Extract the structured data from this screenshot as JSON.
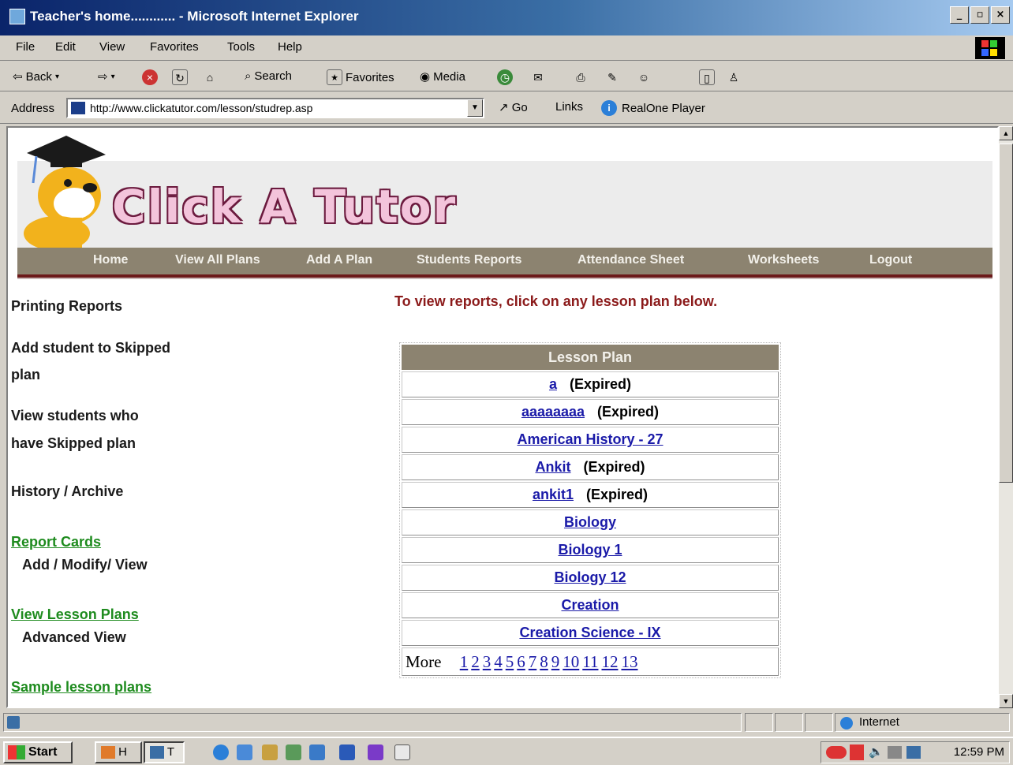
{
  "window": {
    "title": "Teacher's home............ - Microsoft Internet Explorer",
    "buttons": [
      "_",
      "▫",
      "×"
    ]
  },
  "menu": [
    "File",
    "Edit",
    "View",
    "Favorites",
    "Tools",
    "Help"
  ],
  "toolbar": {
    "back": "Back",
    "search": "Search",
    "favorites": "Favorites",
    "media": "Media"
  },
  "address": {
    "label": "Address",
    "url": "http://www.clickatutor.com/lesson/studrep.asp",
    "go": "Go",
    "links": "Links",
    "realone": "RealOne Player"
  },
  "site": {
    "logo": "Click A Tutor",
    "nav": [
      "Home",
      "View All Plans",
      "Add A Plan",
      "Students Reports",
      "Attendance Sheet",
      "Worksheets",
      "Logout"
    ]
  },
  "sidebar": {
    "printing": "Printing Reports",
    "add_skipped_1": "Add student to Skipped",
    "add_skipped_2": "plan",
    "view_skipped_1": "View students who",
    "view_skipped_2": "have Skipped plan",
    "history": "History / Archive",
    "report_cards": "Report Cards",
    "report_cards_sub": "Add / Modify/ View",
    "view_lesson_plans": "View Lesson Plans",
    "advanced_view": "Advanced View",
    "sample_plans": "Sample lesson plans"
  },
  "main": {
    "instruction": "To view reports, click on any lesson plan below.",
    "table_header": "Lesson Plan",
    "plans": [
      {
        "name": "a",
        "status": "(Expired)"
      },
      {
        "name": "aaaaaaaa",
        "status": "(Expired)"
      },
      {
        "name": "American History - 27",
        "status": ""
      },
      {
        "name": "Ankit",
        "status": "(Expired)"
      },
      {
        "name": "ankit1",
        "status": "(Expired)"
      },
      {
        "name": "Biology",
        "status": ""
      },
      {
        "name": "Biology 1",
        "status": ""
      },
      {
        "name": "Biology 12",
        "status": ""
      },
      {
        "name": "Creation",
        "status": ""
      },
      {
        "name": "Creation Science - IX",
        "status": ""
      }
    ],
    "more_label": "More",
    "pages": [
      "1",
      "2",
      "3",
      "4",
      "5",
      "6",
      "7",
      "8",
      "9",
      "10",
      "11",
      "12",
      "13"
    ]
  },
  "status": {
    "zone": "Internet"
  },
  "taskbar": {
    "start": "Start",
    "tasks": [
      "H",
      "T"
    ],
    "clock": "12:59 PM"
  },
  "colors": {
    "nav_bg": "#8c8370",
    "instruction": "#8b1a1a",
    "green_link": "#1e8b1e",
    "blue_link": "#1a1aa8",
    "title_bar": "#0a246a"
  }
}
